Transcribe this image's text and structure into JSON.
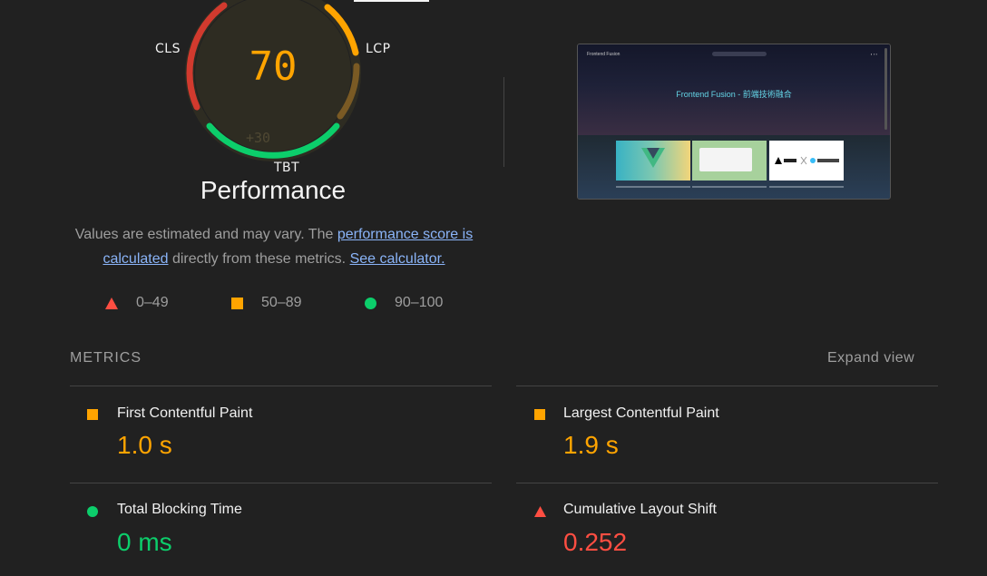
{
  "gauge": {
    "score": "70",
    "delta": "+30",
    "labels": {
      "cls": "CLS",
      "lcp": "LCP",
      "tbt": "TBT"
    }
  },
  "performance_title": "Performance",
  "description": {
    "before": "Values are estimated and may vary. The ",
    "link1": "performance score is calculated",
    "middle": " directly from these metrics. ",
    "link2": "See calculator."
  },
  "legend": [
    {
      "icon": "triangle-icon",
      "range": "0–49",
      "color": "#ff4e42"
    },
    {
      "icon": "square-icon",
      "range": "50–89",
      "color": "#ffa400"
    },
    {
      "icon": "circle-icon",
      "range": "90–100",
      "color": "#0cce6b"
    }
  ],
  "screenshot": {
    "brand": "Frontend Fusion",
    "hero_title": "Frontend Fusion - 前端技術融合"
  },
  "metrics": {
    "heading": "METRICS",
    "expand_label": "Expand view",
    "items": [
      {
        "title": "First Contentful Paint",
        "value": "1.0 s",
        "status": "average",
        "icon": "square-icon"
      },
      {
        "title": "Largest Contentful Paint",
        "value": "1.9 s",
        "status": "average",
        "icon": "square-icon"
      },
      {
        "title": "Total Blocking Time",
        "value": "0 ms",
        "status": "pass",
        "icon": "circle-icon"
      },
      {
        "title": "Cumulative Layout Shift",
        "value": "0.252",
        "status": "fail",
        "icon": "triangle-icon"
      }
    ]
  },
  "colors": {
    "average": "#ffa400",
    "pass": "#0cce6b",
    "fail": "#ff4e42",
    "background": "#212121"
  }
}
